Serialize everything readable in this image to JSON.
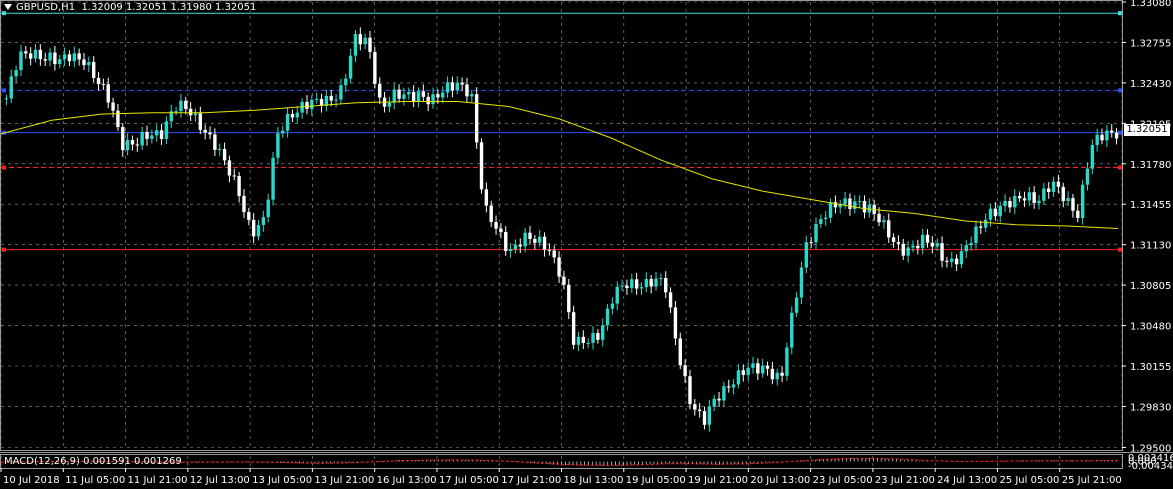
{
  "header": {
    "symbol": "GBPUSD,H1",
    "ohlc": "1.32009 1.32051 1.31980 1.32051"
  },
  "macd": {
    "label": "MACD(12,26,9) 0.001591 0.001269",
    "ticks": [
      "0.003416",
      "0.000",
      "-0.004345"
    ]
  },
  "current_price": "1.32051",
  "colors": {
    "background": "#000000",
    "grid": "#9a9a9a",
    "bull_candle": "#2bd9c9",
    "bear_candle": "#ffffff",
    "moving_average": "#e6e600",
    "macd_hist": "#cfcfcf",
    "macd_signal": "#ff2020",
    "line_cyan": "#40e0e0",
    "line_blue": "#3050ff",
    "line_red": "#ff2020"
  },
  "chart_data": {
    "type": "candlestick",
    "symbol": "GBPUSD",
    "timeframe": "H1",
    "y_ticks": [
      "1.33080",
      "1.32755",
      "1.32430",
      "1.32105",
      "1.31780",
      "1.31455",
      "1.31130",
      "1.30805",
      "1.30480",
      "1.30155",
      "1.29830",
      "1.29500"
    ],
    "ylim": [
      1.2948,
      1.3308
    ],
    "x_ticks": [
      "10 Jul 2018",
      "11 Jul 05:00",
      "11 Jul 21:00",
      "12 Jul 13:00",
      "13 Jul 05:00",
      "13 Jul 21:00",
      "16 Jul 13:00",
      "17 Jul 05:00",
      "17 Jul 21:00",
      "18 Jul 13:00",
      "19 Jul 05:00",
      "19 Jul 21:00",
      "20 Jul 13:00",
      "23 Jul 05:00",
      "23 Jul 21:00",
      "24 Jul 13:00",
      "25 Jul 05:00",
      "25 Jul 21:00"
    ],
    "horizontal_lines": [
      {
        "price": 1.3299,
        "color": "#40e0e0",
        "style": "solid"
      },
      {
        "price": 1.3237,
        "color": "#3050ff",
        "style": "dashed"
      },
      {
        "price": 1.3203,
        "color": "#3050ff",
        "style": "solid"
      },
      {
        "price": 1.3175,
        "color": "#ff2020",
        "style": "dashed"
      },
      {
        "price": 1.3109,
        "color": "#ff2020",
        "style": "solid"
      }
    ],
    "close_path": [
      1.3228,
      1.3265,
      1.327,
      1.3262,
      1.3258,
      1.3268,
      1.3262,
      1.3242,
      1.323,
      1.3196,
      1.3192,
      1.32,
      1.3205,
      1.3224,
      1.322,
      1.3211,
      1.3198,
      1.3175,
      1.3155,
      1.3125,
      1.3132,
      1.32,
      1.322,
      1.3225,
      1.3225,
      1.323,
      1.324,
      1.3276,
      1.3275,
      1.3226,
      1.3232,
      1.323,
      1.3236,
      1.323,
      1.3235,
      1.3243,
      1.3238,
      1.314,
      1.3124,
      1.311,
      1.3118,
      1.3114,
      1.3112,
      1.309,
      1.303,
      1.3036,
      1.3045,
      1.307,
      1.308,
      1.3083,
      1.3084,
      1.308,
      1.303,
      1.2988,
      1.2968,
      1.299,
      1.3003,
      1.301,
      1.3012,
      1.3015,
      1.3005,
      1.306,
      1.3115,
      1.3135,
      1.3142,
      1.3145,
      1.315,
      1.314,
      1.3125,
      1.3113,
      1.311,
      1.3114,
      1.3112,
      1.31,
      1.3103,
      1.312,
      1.314,
      1.3143,
      1.3145,
      1.3154,
      1.3151,
      1.316,
      1.315,
      1.314,
      1.319,
      1.32,
      1.3205
    ],
    "moving_average_path": [
      1.3202,
      1.3213,
      1.3218,
      1.3219,
      1.3219,
      1.3221,
      1.3224,
      1.3227,
      1.3228,
      1.3228,
      1.3224,
      1.3214,
      1.3199,
      1.3181,
      1.3166,
      1.3156,
      1.3149,
      1.3142,
      1.3138,
      1.3132,
      1.3129,
      1.3128,
      1.3126
    ],
    "macd_hist": [
      -0.0004,
      0.0,
      0.0002,
      0.0002,
      0.0001,
      -0.0004,
      -0.0008,
      -0.0008,
      -0.0006,
      -0.0004,
      -0.0008,
      -0.0016,
      -0.002,
      -0.001,
      0.0003,
      0.0013,
      0.0015,
      0.0016,
      0.0013,
      0.0,
      -0.0015,
      -0.0033,
      -0.0038,
      -0.004,
      -0.003,
      -0.0018,
      -0.0023,
      -0.003,
      -0.0022,
      -0.001,
      0.0008,
      0.0026,
      0.0034,
      0.0032,
      0.0018,
      0.0002,
      -0.0004,
      0.0002,
      0.0007,
      0.0009,
      0.001,
      0.0009,
      0.0013
    ],
    "macd_signal": [
      -0.0006,
      -0.0002,
      0.0,
      0.0001,
      0.0001,
      -0.0002,
      -0.0006,
      -0.0007,
      -0.0006,
      -0.0004,
      -0.0006,
      -0.0012,
      -0.0017,
      -0.0013,
      -0.0003,
      0.0008,
      0.0013,
      0.0015,
      0.0014,
      0.0004,
      -0.0011,
      -0.0026,
      -0.0035,
      -0.0038,
      -0.0032,
      -0.0022,
      -0.0022,
      -0.0026,
      -0.0023,
      -0.0012,
      0.0004,
      0.002,
      0.0031,
      0.0031,
      0.0022,
      0.0008,
      0.0001,
      0.0001,
      0.0005,
      0.0007,
      0.0008,
      0.0008,
      0.0011
    ],
    "macd_ylim": [
      -0.004345,
      0.003416
    ]
  }
}
